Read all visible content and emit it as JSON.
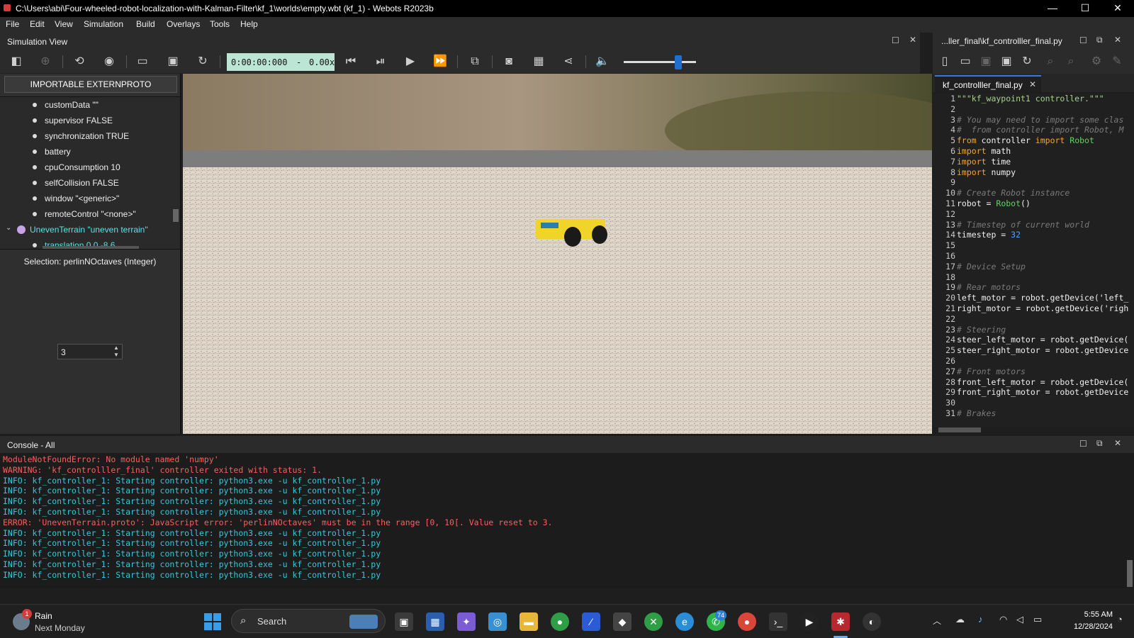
{
  "window": {
    "title": "C:\\Users\\abi\\Four-wheeled-robot-localization-with-Kalman-Filter\\kf_1\\worlds\\empty.wbt (kf_1) - Webots R2023b",
    "minimize": "—",
    "maximize": "☐",
    "close": "✕"
  },
  "menu": [
    "File",
    "Edit",
    "View",
    "Simulation",
    "Build",
    "Overlays",
    "Tools",
    "Help"
  ],
  "sim_view": {
    "label": "Simulation View",
    "time": "0:00:00:000",
    "dash": "-",
    "speed": "0.00x"
  },
  "volume": 0.75,
  "left_panel": {
    "extproto_button": "IMPORTABLE EXTERNPROTO",
    "tree": [
      "customData \"\"",
      "supervisor FALSE",
      "synchronization TRUE",
      "battery",
      "cpuConsumption 10",
      "selfCollision FALSE",
      "window \"<generic>\"",
      "remoteControl \"<none>\""
    ],
    "uneven_node": "UnevenTerrain \"uneven terrain\"",
    "translation_row": "translation 0 0 -8.6",
    "selection": "Selection: perlinNOctaves (Integer)",
    "spin_value": "3"
  },
  "editor": {
    "header": "...ller_final\\kf_controlller_final.py",
    "tab": "kf_controlller_final.py",
    "tab_close": "✕",
    "lines": [
      {
        "n": "1",
        "t": "\"\"\"kf_waypoint1 controller.\"\"\"",
        "k": "str"
      },
      {
        "n": "2",
        "t": "",
        "k": ""
      },
      {
        "n": "3",
        "t": "# You may need to import some clas",
        "k": "com"
      },
      {
        "n": "4",
        "t": "#  from controller import Robot, M",
        "k": "com"
      },
      {
        "n": "5",
        "t": "",
        "k": "import1"
      },
      {
        "n": "6",
        "t": "",
        "k": "import2"
      },
      {
        "n": "7",
        "t": "",
        "k": "import3"
      },
      {
        "n": "8",
        "t": "",
        "k": "import4"
      },
      {
        "n": "9",
        "t": "",
        "k": ""
      },
      {
        "n": "10",
        "t": "# Create Robot instance",
        "k": "com"
      },
      {
        "n": "11",
        "t": "",
        "k": "robot"
      },
      {
        "n": "12",
        "t": "",
        "k": ""
      },
      {
        "n": "13",
        "t": "# Timestep of current world",
        "k": "com"
      },
      {
        "n": "14",
        "t": "",
        "k": "timestep"
      },
      {
        "n": "15",
        "t": "",
        "k": ""
      },
      {
        "n": "16",
        "t": "",
        "k": ""
      },
      {
        "n": "17",
        "t": "# Device Setup",
        "k": "com"
      },
      {
        "n": "18",
        "t": "",
        "k": ""
      },
      {
        "n": "19",
        "t": "# Rear motors",
        "k": "com"
      },
      {
        "n": "20",
        "t": "left_motor = robot.getDevice('left_",
        "k": "plain"
      },
      {
        "n": "21",
        "t": "right_motor = robot.getDevice('righ",
        "k": "plain"
      },
      {
        "n": "22",
        "t": "",
        "k": ""
      },
      {
        "n": "23",
        "t": "# Steering",
        "k": "com"
      },
      {
        "n": "24",
        "t": "steer_left_motor = robot.getDevice(",
        "k": "plain"
      },
      {
        "n": "25",
        "t": "steer_right_motor = robot.getDevice",
        "k": "plain"
      },
      {
        "n": "26",
        "t": "",
        "k": ""
      },
      {
        "n": "27",
        "t": "# Front motors",
        "k": "com"
      },
      {
        "n": "28",
        "t": "front_left_motor = robot.getDevice(",
        "k": "plain"
      },
      {
        "n": "29",
        "t": "front_right_motor = robot.getDevice",
        "k": "plain"
      },
      {
        "n": "30",
        "t": "",
        "k": ""
      },
      {
        "n": "31",
        "t": "# Brakes",
        "k": "com"
      }
    ],
    "tokens": {
      "from": "from",
      "controller": " controller ",
      "import": "import",
      "robot_cls": " Robot",
      "math": " math",
      "time": " time",
      "numpy": " numpy",
      "robot_assign": "robot = ",
      "robot_call": "Robot",
      "parens": "()",
      "timestep_assign": "timestep = ",
      "timestep_val": "32"
    }
  },
  "console": {
    "label": "Console - All",
    "lines": [
      {
        "t": "ModuleNotFoundError: No module named 'numpy'",
        "k": "err"
      },
      {
        "t": "WARNING: 'kf_controlller_final' controller exited with status: 1.",
        "k": "err"
      },
      {
        "t": "INFO: kf_controller_1: Starting controller: python3.exe -u kf_controller_1.py",
        "k": "info"
      },
      {
        "t": "INFO: kf_controller_1: Starting controller: python3.exe -u kf_controller_1.py",
        "k": "info"
      },
      {
        "t": "INFO: kf_controller_1: Starting controller: python3.exe -u kf_controller_1.py",
        "k": "info"
      },
      {
        "t": "INFO: kf_controller_1: Starting controller: python3.exe -u kf_controller_1.py",
        "k": "info"
      },
      {
        "t": "ERROR: 'UnevenTerrain.proto': JavaScript error: 'perlinNOctaves' must be in the range [0, 10[. Value reset to 3.",
        "k": "err"
      },
      {
        "t": "INFO: kf_controller_1: Starting controller: python3.exe -u kf_controller_1.py",
        "k": "info"
      },
      {
        "t": "INFO: kf_controller_1: Starting controller: python3.exe -u kf_controller_1.py",
        "k": "info"
      },
      {
        "t": "INFO: kf_controller_1: Starting controller: python3.exe -u kf_controller_1.py",
        "k": "info"
      },
      {
        "t": "INFO: kf_controller_1: Starting controller: python3.exe -u kf_controller_1.py",
        "k": "info"
      },
      {
        "t": "INFO: kf_controller_1: Starting controller: python3.exe -u kf_controller_1.py",
        "k": "info"
      }
    ]
  },
  "taskbar": {
    "weather_title": "Rain",
    "weather_sub": "Next Monday",
    "weather_badge": "1",
    "search_placeholder": "Search",
    "whatsapp_badge": "74",
    "time": "5:55 AM",
    "date": "12/28/2024"
  },
  "colors": {
    "accent": "#1f6fd1",
    "time_box": "#bde5d6",
    "error": "#ff5d5d",
    "info": "#36c7d9",
    "robot": "#f0d42a"
  }
}
